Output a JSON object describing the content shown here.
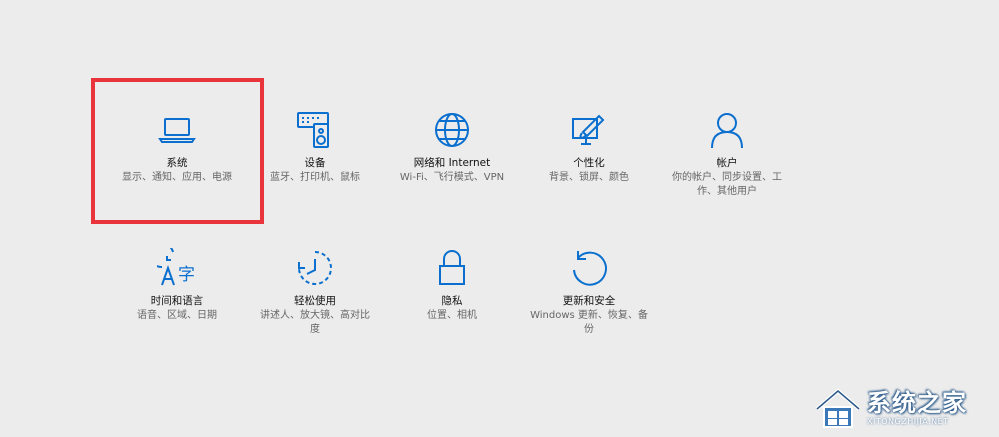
{
  "accent_color": "#0a6fce",
  "highlight_color": "#e8343a",
  "tiles": [
    {
      "icon": "laptop-icon",
      "title": "系统",
      "desc": "显示、通知、应用、电源"
    },
    {
      "icon": "devices-icon",
      "title": "设备",
      "desc": "蓝牙、打印机、鼠标"
    },
    {
      "icon": "globe-icon",
      "title": "网络和 Internet",
      "desc": "Wi-Fi、飞行模式、VPN"
    },
    {
      "icon": "personalization-icon",
      "title": "个性化",
      "desc": "背景、锁屏、颜色"
    },
    {
      "icon": "person-icon",
      "title": "帐户",
      "desc": "你的帐户、同步设置、工作、其他用户"
    },
    {
      "icon": "time-language-icon",
      "title": "时间和语言",
      "desc": "语音、区域、日期"
    },
    {
      "icon": "ease-of-access-icon",
      "title": "轻松使用",
      "desc": "讲述人、放大镜、高对比度"
    },
    {
      "icon": "lock-icon",
      "title": "隐私",
      "desc": "位置、相机"
    },
    {
      "icon": "update-icon",
      "title": "更新和安全",
      "desc": "Windows 更新、恢复、备份"
    }
  ],
  "watermark": {
    "text": "系统之家",
    "subtext": "XITONGZHIJIA.NET"
  }
}
